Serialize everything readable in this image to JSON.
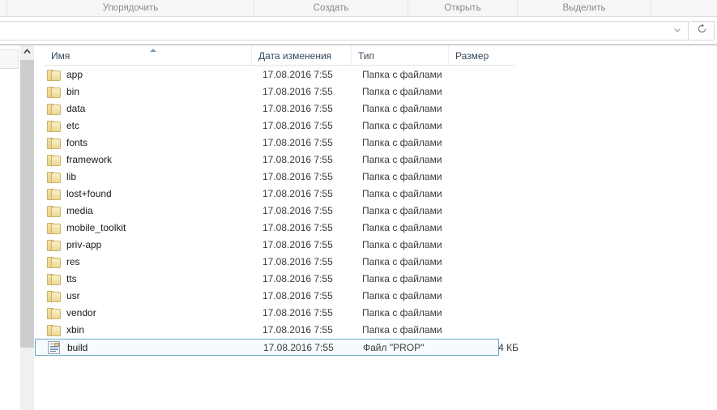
{
  "ribbon": {
    "groups": [
      {
        "label": ""
      },
      {
        "label": "Упорядочить"
      },
      {
        "label": "Создать"
      },
      {
        "label": "Открыть"
      },
      {
        "label": "Выделить"
      },
      {
        "label": ""
      }
    ]
  },
  "address": {
    "value": "",
    "chevron_icon": "chevron-down-icon",
    "refresh_icon": "refresh-icon",
    "refresh_glyph": "↻"
  },
  "scrollbar": {
    "up_glyph": "⌃"
  },
  "columns": {
    "name": "Имя",
    "date_modified": "Дата изменения",
    "type": "Тип",
    "size": "Размер",
    "sort_column": "Имя",
    "sort_direction": "ascending"
  },
  "files": [
    {
      "name": "app",
      "date": "17.08.2016 7:55",
      "type": "Папка с файлами",
      "size": "",
      "icon": "folder-icon",
      "selected": false
    },
    {
      "name": "bin",
      "date": "17.08.2016 7:55",
      "type": "Папка с файлами",
      "size": "",
      "icon": "folder-icon",
      "selected": false
    },
    {
      "name": "data",
      "date": "17.08.2016 7:55",
      "type": "Папка с файлами",
      "size": "",
      "icon": "folder-icon",
      "selected": false
    },
    {
      "name": "etc",
      "date": "17.08.2016 7:55",
      "type": "Папка с файлами",
      "size": "",
      "icon": "folder-icon",
      "selected": false
    },
    {
      "name": "fonts",
      "date": "17.08.2016 7:55",
      "type": "Папка с файлами",
      "size": "",
      "icon": "folder-icon",
      "selected": false
    },
    {
      "name": "framework",
      "date": "17.08.2016 7:55",
      "type": "Папка с файлами",
      "size": "",
      "icon": "folder-icon",
      "selected": false
    },
    {
      "name": "lib",
      "date": "17.08.2016 7:55",
      "type": "Папка с файлами",
      "size": "",
      "icon": "folder-icon",
      "selected": false
    },
    {
      "name": "lost+found",
      "date": "17.08.2016 7:55",
      "type": "Папка с файлами",
      "size": "",
      "icon": "folder-icon",
      "selected": false
    },
    {
      "name": "media",
      "date": "17.08.2016 7:55",
      "type": "Папка с файлами",
      "size": "",
      "icon": "folder-icon",
      "selected": false
    },
    {
      "name": "mobile_toolkit",
      "date": "17.08.2016 7:55",
      "type": "Папка с файлами",
      "size": "",
      "icon": "folder-icon",
      "selected": false
    },
    {
      "name": "priv-app",
      "date": "17.08.2016 7:55",
      "type": "Папка с файлами",
      "size": "",
      "icon": "folder-icon",
      "selected": false
    },
    {
      "name": "res",
      "date": "17.08.2016 7:55",
      "type": "Папка с файлами",
      "size": "",
      "icon": "folder-icon",
      "selected": false
    },
    {
      "name": "tts",
      "date": "17.08.2016 7:55",
      "type": "Папка с файлами",
      "size": "",
      "icon": "folder-icon",
      "selected": false
    },
    {
      "name": "usr",
      "date": "17.08.2016 7:55",
      "type": "Папка с файлами",
      "size": "",
      "icon": "folder-icon",
      "selected": false
    },
    {
      "name": "vendor",
      "date": "17.08.2016 7:55",
      "type": "Папка с файлами",
      "size": "",
      "icon": "folder-icon",
      "selected": false
    },
    {
      "name": "xbin",
      "date": "17.08.2016 7:55",
      "type": "Папка с файлами",
      "size": "",
      "icon": "folder-icon",
      "selected": false
    },
    {
      "name": "build",
      "date": "17.08.2016 7:55",
      "type": "Файл \"PROP\"",
      "size": "4 КБ",
      "icon": "prop-file-icon",
      "selected": true
    }
  ],
  "colors": {
    "selection_border": "#63a9c4",
    "selection_fill": "#f7fbfd",
    "header_text": "#34495e",
    "ribbon_text": "#8a8a8a",
    "sort_arrow": "#7d9bb5"
  }
}
